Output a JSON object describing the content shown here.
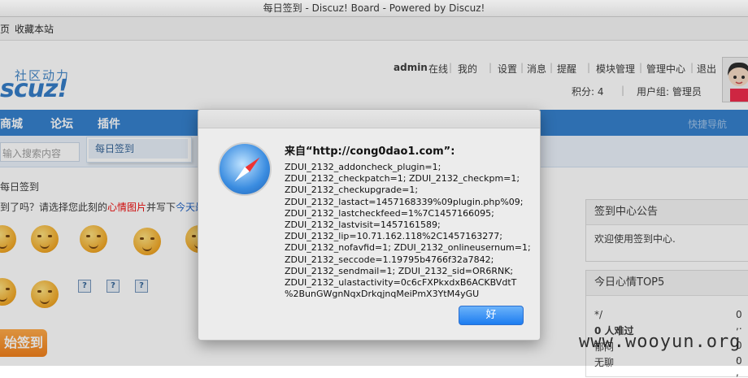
{
  "window": {
    "title": "每日签到 - Discuz! Board - Powered by Discuz!"
  },
  "bookmarks": {
    "item1": "页",
    "item2": "收藏本站"
  },
  "header": {
    "logo_tag": "社区动力",
    "logo_text": "scuz!",
    "user": "admin",
    "online": "在线",
    "mine": "我的",
    "settings": "设置",
    "messages": "消息",
    "reminders": "提醒",
    "module_manage": "模块管理",
    "admin_center": "管理中心",
    "logout": "退出",
    "points": "积分: 4",
    "group": "用户组: 管理员"
  },
  "nav": {
    "items": [
      "商城",
      "论坛",
      "插件"
    ],
    "quick_nav": "快捷导航",
    "search_placeholder": "输入搜索内容",
    "dropdown_item": "每日签到"
  },
  "content": {
    "crumb": "每日签到",
    "prompt_a": "到了吗？请选择您此刻的",
    "prompt_red": "心情图片",
    "prompt_b": "并写下",
    "prompt_blue": "今天最",
    "sign_button": "始签到"
  },
  "right": {
    "announce_title": "签到中心公告",
    "announce_body": "欢迎使用签到中心.",
    "top5_title": "今日心情TOP5",
    "rows": [
      {
        "label": "*/",
        "count": "0 ,."
      },
      {
        "label": "0 人难过",
        "count": ""
      },
      {
        "label": "郁闷",
        "count": "0 ,"
      },
      {
        "label": "无聊",
        "count": "0 ,"
      }
    ]
  },
  "dialog": {
    "title": "来自“http://cong0dao1.com”:",
    "lines": [
      "ZDUI_2132_addoncheck_plugin=1;",
      "ZDUI_2132_checkpatch=1; ZDUI_2132_checkpm=1;",
      "ZDUI_2132_checkupgrade=1;",
      "ZDUI_2132_lastact=1457168339%09plugin.php%09;",
      "ZDUI_2132_lastcheckfeed=1%7C1457166095;",
      "ZDUI_2132_lastvisit=1457161589;",
      "ZDUI_2132_lip=10.71.162.118%2C1457163277;",
      "ZDUI_2132_nofavfid=1; ZDUI_2132_onlineusernum=1;",
      "ZDUI_2132_seccode=1.19795b4766f32a7842;",
      "ZDUI_2132_sendmail=1; ZDUI_2132_sid=OR6RNK;",
      "ZDUI_2132_ulastactivity=0c6cFXPkxdxB6ACKBVdtT",
      "%2BunGWgnNqxDrkqjnqMeiPmX3YtM4yGU"
    ],
    "ok": "好"
  },
  "watermark": "www.wooyun.org"
}
